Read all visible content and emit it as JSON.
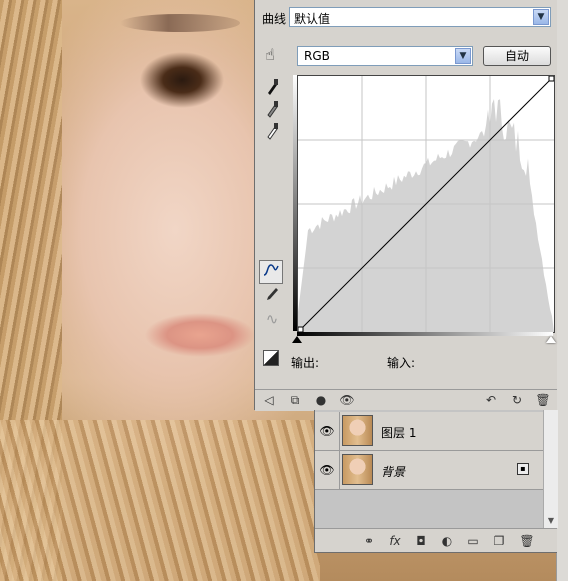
{
  "curves": {
    "title": "曲线",
    "preset": "默认值",
    "channel": "RGB",
    "auto_label": "自动",
    "output_label": "输出:",
    "input_label": "输入:"
  },
  "layers": [
    {
      "name": "图层 1",
      "visible": true
    },
    {
      "name": "背景",
      "visible": true,
      "locked": true
    }
  ],
  "icons": {
    "adjust": "click-drag-adjust-icon",
    "black_point": "black-eyedropper-icon",
    "gray_point": "gray-eyedropper-icon",
    "white_point": "white-eyedropper-icon",
    "curve_tool": "curve-points-icon",
    "pencil_tool": "pencil-icon",
    "smooth_tool": "smooth-icon",
    "clipping": "show-clipping-icon",
    "eye": "eye-icon",
    "lock": "lock-icon"
  },
  "colors": {
    "panel_bg": "#d6d3ce",
    "histogram": "#d3d3d3",
    "curve_line": "#000000"
  }
}
